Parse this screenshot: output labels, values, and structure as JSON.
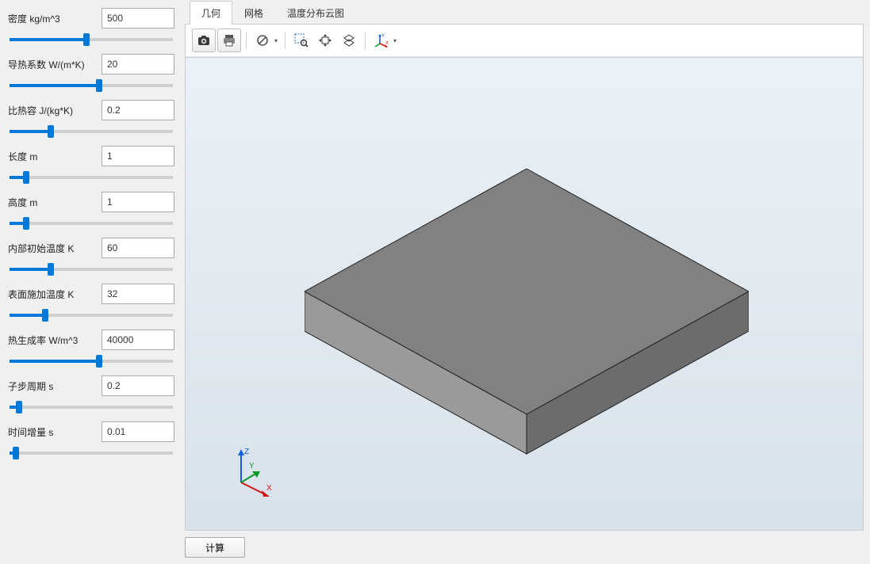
{
  "params": [
    {
      "label": "密度 kg/m^3",
      "value": "500",
      "fill": 47
    },
    {
      "label": "导热系数 W/(m*K)",
      "value": "20",
      "fill": 55
    },
    {
      "label": "比热容 J/(kg*K)",
      "value": "0.2",
      "fill": 25
    },
    {
      "label": "长度 m",
      "value": "1",
      "fill": 10
    },
    {
      "label": "高度 m",
      "value": "1",
      "fill": 10
    },
    {
      "label": "内部初始温度 K",
      "value": "60",
      "fill": 25
    },
    {
      "label": "表面施加温度 K",
      "value": "32",
      "fill": 22
    },
    {
      "label": "热生成率 W/m^3",
      "value": "40000",
      "fill": 55
    },
    {
      "label": "子步周期 s",
      "value": "0.2",
      "fill": 6
    },
    {
      "label": "时间增量 s",
      "value": "0.01",
      "fill": 4
    }
  ],
  "tabs": [
    {
      "label": "几何",
      "active": true
    },
    {
      "label": "网格",
      "active": false
    },
    {
      "label": "温度分布云图",
      "active": false
    }
  ],
  "toolbar": {
    "camera": "camera-icon",
    "print": "print-icon",
    "nosymbol": "nosymbol-icon",
    "zoomregion": "zoom-region-icon",
    "pan": "pan-icon",
    "rotate": "rotate-icon",
    "axes": "axes-icon"
  },
  "axes_labels": {
    "x": "X",
    "y": "Y",
    "z": "Z"
  },
  "calc_button": "计算",
  "colors": {
    "accent": "#0078d7",
    "box_top": "#7f7f7f",
    "box_side_light": "#949494",
    "box_side_dark": "#6c6c6c"
  }
}
